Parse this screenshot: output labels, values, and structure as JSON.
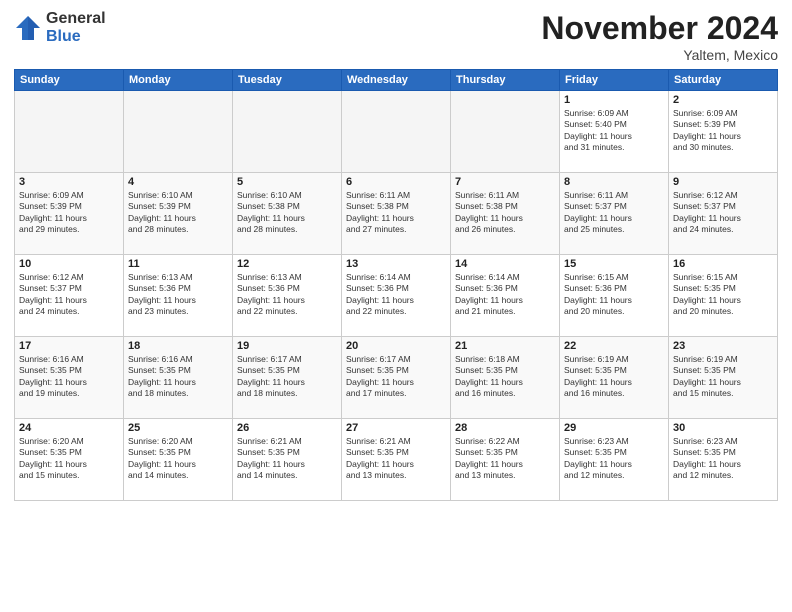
{
  "logo": {
    "general": "General",
    "blue": "Blue"
  },
  "header": {
    "title": "November 2024",
    "subtitle": "Yaltem, Mexico"
  },
  "weekdays": [
    "Sunday",
    "Monday",
    "Tuesday",
    "Wednesday",
    "Thursday",
    "Friday",
    "Saturday"
  ],
  "weeks": [
    [
      {
        "day": "",
        "info": ""
      },
      {
        "day": "",
        "info": ""
      },
      {
        "day": "",
        "info": ""
      },
      {
        "day": "",
        "info": ""
      },
      {
        "day": "",
        "info": ""
      },
      {
        "day": "1",
        "info": "Sunrise: 6:09 AM\nSunset: 5:40 PM\nDaylight: 11 hours\nand 31 minutes."
      },
      {
        "day": "2",
        "info": "Sunrise: 6:09 AM\nSunset: 5:39 PM\nDaylight: 11 hours\nand 30 minutes."
      }
    ],
    [
      {
        "day": "3",
        "info": "Sunrise: 6:09 AM\nSunset: 5:39 PM\nDaylight: 11 hours\nand 29 minutes."
      },
      {
        "day": "4",
        "info": "Sunrise: 6:10 AM\nSunset: 5:39 PM\nDaylight: 11 hours\nand 28 minutes."
      },
      {
        "day": "5",
        "info": "Sunrise: 6:10 AM\nSunset: 5:38 PM\nDaylight: 11 hours\nand 28 minutes."
      },
      {
        "day": "6",
        "info": "Sunrise: 6:11 AM\nSunset: 5:38 PM\nDaylight: 11 hours\nand 27 minutes."
      },
      {
        "day": "7",
        "info": "Sunrise: 6:11 AM\nSunset: 5:38 PM\nDaylight: 11 hours\nand 26 minutes."
      },
      {
        "day": "8",
        "info": "Sunrise: 6:11 AM\nSunset: 5:37 PM\nDaylight: 11 hours\nand 25 minutes."
      },
      {
        "day": "9",
        "info": "Sunrise: 6:12 AM\nSunset: 5:37 PM\nDaylight: 11 hours\nand 24 minutes."
      }
    ],
    [
      {
        "day": "10",
        "info": "Sunrise: 6:12 AM\nSunset: 5:37 PM\nDaylight: 11 hours\nand 24 minutes."
      },
      {
        "day": "11",
        "info": "Sunrise: 6:13 AM\nSunset: 5:36 PM\nDaylight: 11 hours\nand 23 minutes."
      },
      {
        "day": "12",
        "info": "Sunrise: 6:13 AM\nSunset: 5:36 PM\nDaylight: 11 hours\nand 22 minutes."
      },
      {
        "day": "13",
        "info": "Sunrise: 6:14 AM\nSunset: 5:36 PM\nDaylight: 11 hours\nand 22 minutes."
      },
      {
        "day": "14",
        "info": "Sunrise: 6:14 AM\nSunset: 5:36 PM\nDaylight: 11 hours\nand 21 minutes."
      },
      {
        "day": "15",
        "info": "Sunrise: 6:15 AM\nSunset: 5:36 PM\nDaylight: 11 hours\nand 20 minutes."
      },
      {
        "day": "16",
        "info": "Sunrise: 6:15 AM\nSunset: 5:35 PM\nDaylight: 11 hours\nand 20 minutes."
      }
    ],
    [
      {
        "day": "17",
        "info": "Sunrise: 6:16 AM\nSunset: 5:35 PM\nDaylight: 11 hours\nand 19 minutes."
      },
      {
        "day": "18",
        "info": "Sunrise: 6:16 AM\nSunset: 5:35 PM\nDaylight: 11 hours\nand 18 minutes."
      },
      {
        "day": "19",
        "info": "Sunrise: 6:17 AM\nSunset: 5:35 PM\nDaylight: 11 hours\nand 18 minutes."
      },
      {
        "day": "20",
        "info": "Sunrise: 6:17 AM\nSunset: 5:35 PM\nDaylight: 11 hours\nand 17 minutes."
      },
      {
        "day": "21",
        "info": "Sunrise: 6:18 AM\nSunset: 5:35 PM\nDaylight: 11 hours\nand 16 minutes."
      },
      {
        "day": "22",
        "info": "Sunrise: 6:19 AM\nSunset: 5:35 PM\nDaylight: 11 hours\nand 16 minutes."
      },
      {
        "day": "23",
        "info": "Sunrise: 6:19 AM\nSunset: 5:35 PM\nDaylight: 11 hours\nand 15 minutes."
      }
    ],
    [
      {
        "day": "24",
        "info": "Sunrise: 6:20 AM\nSunset: 5:35 PM\nDaylight: 11 hours\nand 15 minutes."
      },
      {
        "day": "25",
        "info": "Sunrise: 6:20 AM\nSunset: 5:35 PM\nDaylight: 11 hours\nand 14 minutes."
      },
      {
        "day": "26",
        "info": "Sunrise: 6:21 AM\nSunset: 5:35 PM\nDaylight: 11 hours\nand 14 minutes."
      },
      {
        "day": "27",
        "info": "Sunrise: 6:21 AM\nSunset: 5:35 PM\nDaylight: 11 hours\nand 13 minutes."
      },
      {
        "day": "28",
        "info": "Sunrise: 6:22 AM\nSunset: 5:35 PM\nDaylight: 11 hours\nand 13 minutes."
      },
      {
        "day": "29",
        "info": "Sunrise: 6:23 AM\nSunset: 5:35 PM\nDaylight: 11 hours\nand 12 minutes."
      },
      {
        "day": "30",
        "info": "Sunrise: 6:23 AM\nSunset: 5:35 PM\nDaylight: 11 hours\nand 12 minutes."
      }
    ]
  ]
}
